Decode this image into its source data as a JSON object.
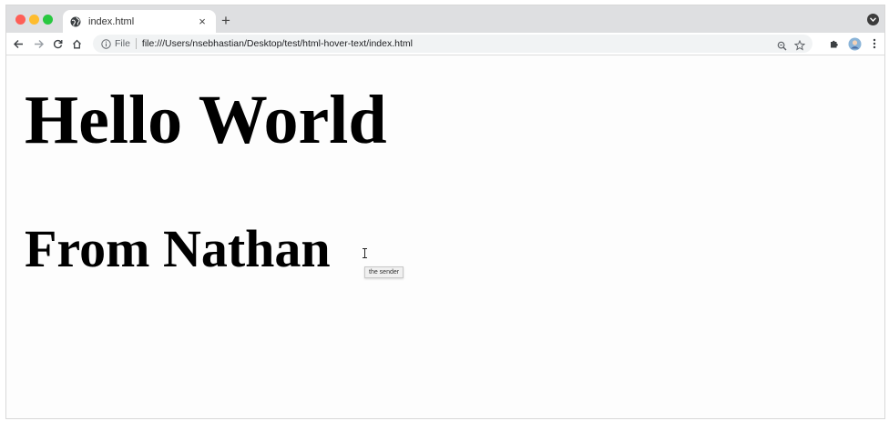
{
  "browser": {
    "tab": {
      "title": "index.html",
      "icon": "globe-icon",
      "close_icon": "close-icon"
    },
    "new_tab_label": "+",
    "toolbar": {
      "back_icon": "back-arrow-icon",
      "forward_icon": "forward-arrow-icon",
      "reload_icon": "reload-icon",
      "home_icon": "home-icon",
      "scheme_label": "File",
      "url": "file:///Users/nsebhastian/Desktop/test/html-hover-text/index.html",
      "right_icons": [
        "zoom-icon",
        "star-icon",
        "extensions-icon",
        "profile-avatar",
        "menu-icon"
      ]
    }
  },
  "page": {
    "heading": "Hello World",
    "subheading": "From Nathan",
    "tooltip": "the sender"
  },
  "colors": {
    "close_red": "#fe5f57",
    "minimize_yellow": "#febc2e",
    "zoom_green": "#28c840",
    "tabstrip": "#dedfe1",
    "omnibox": "#f1f3f4"
  }
}
